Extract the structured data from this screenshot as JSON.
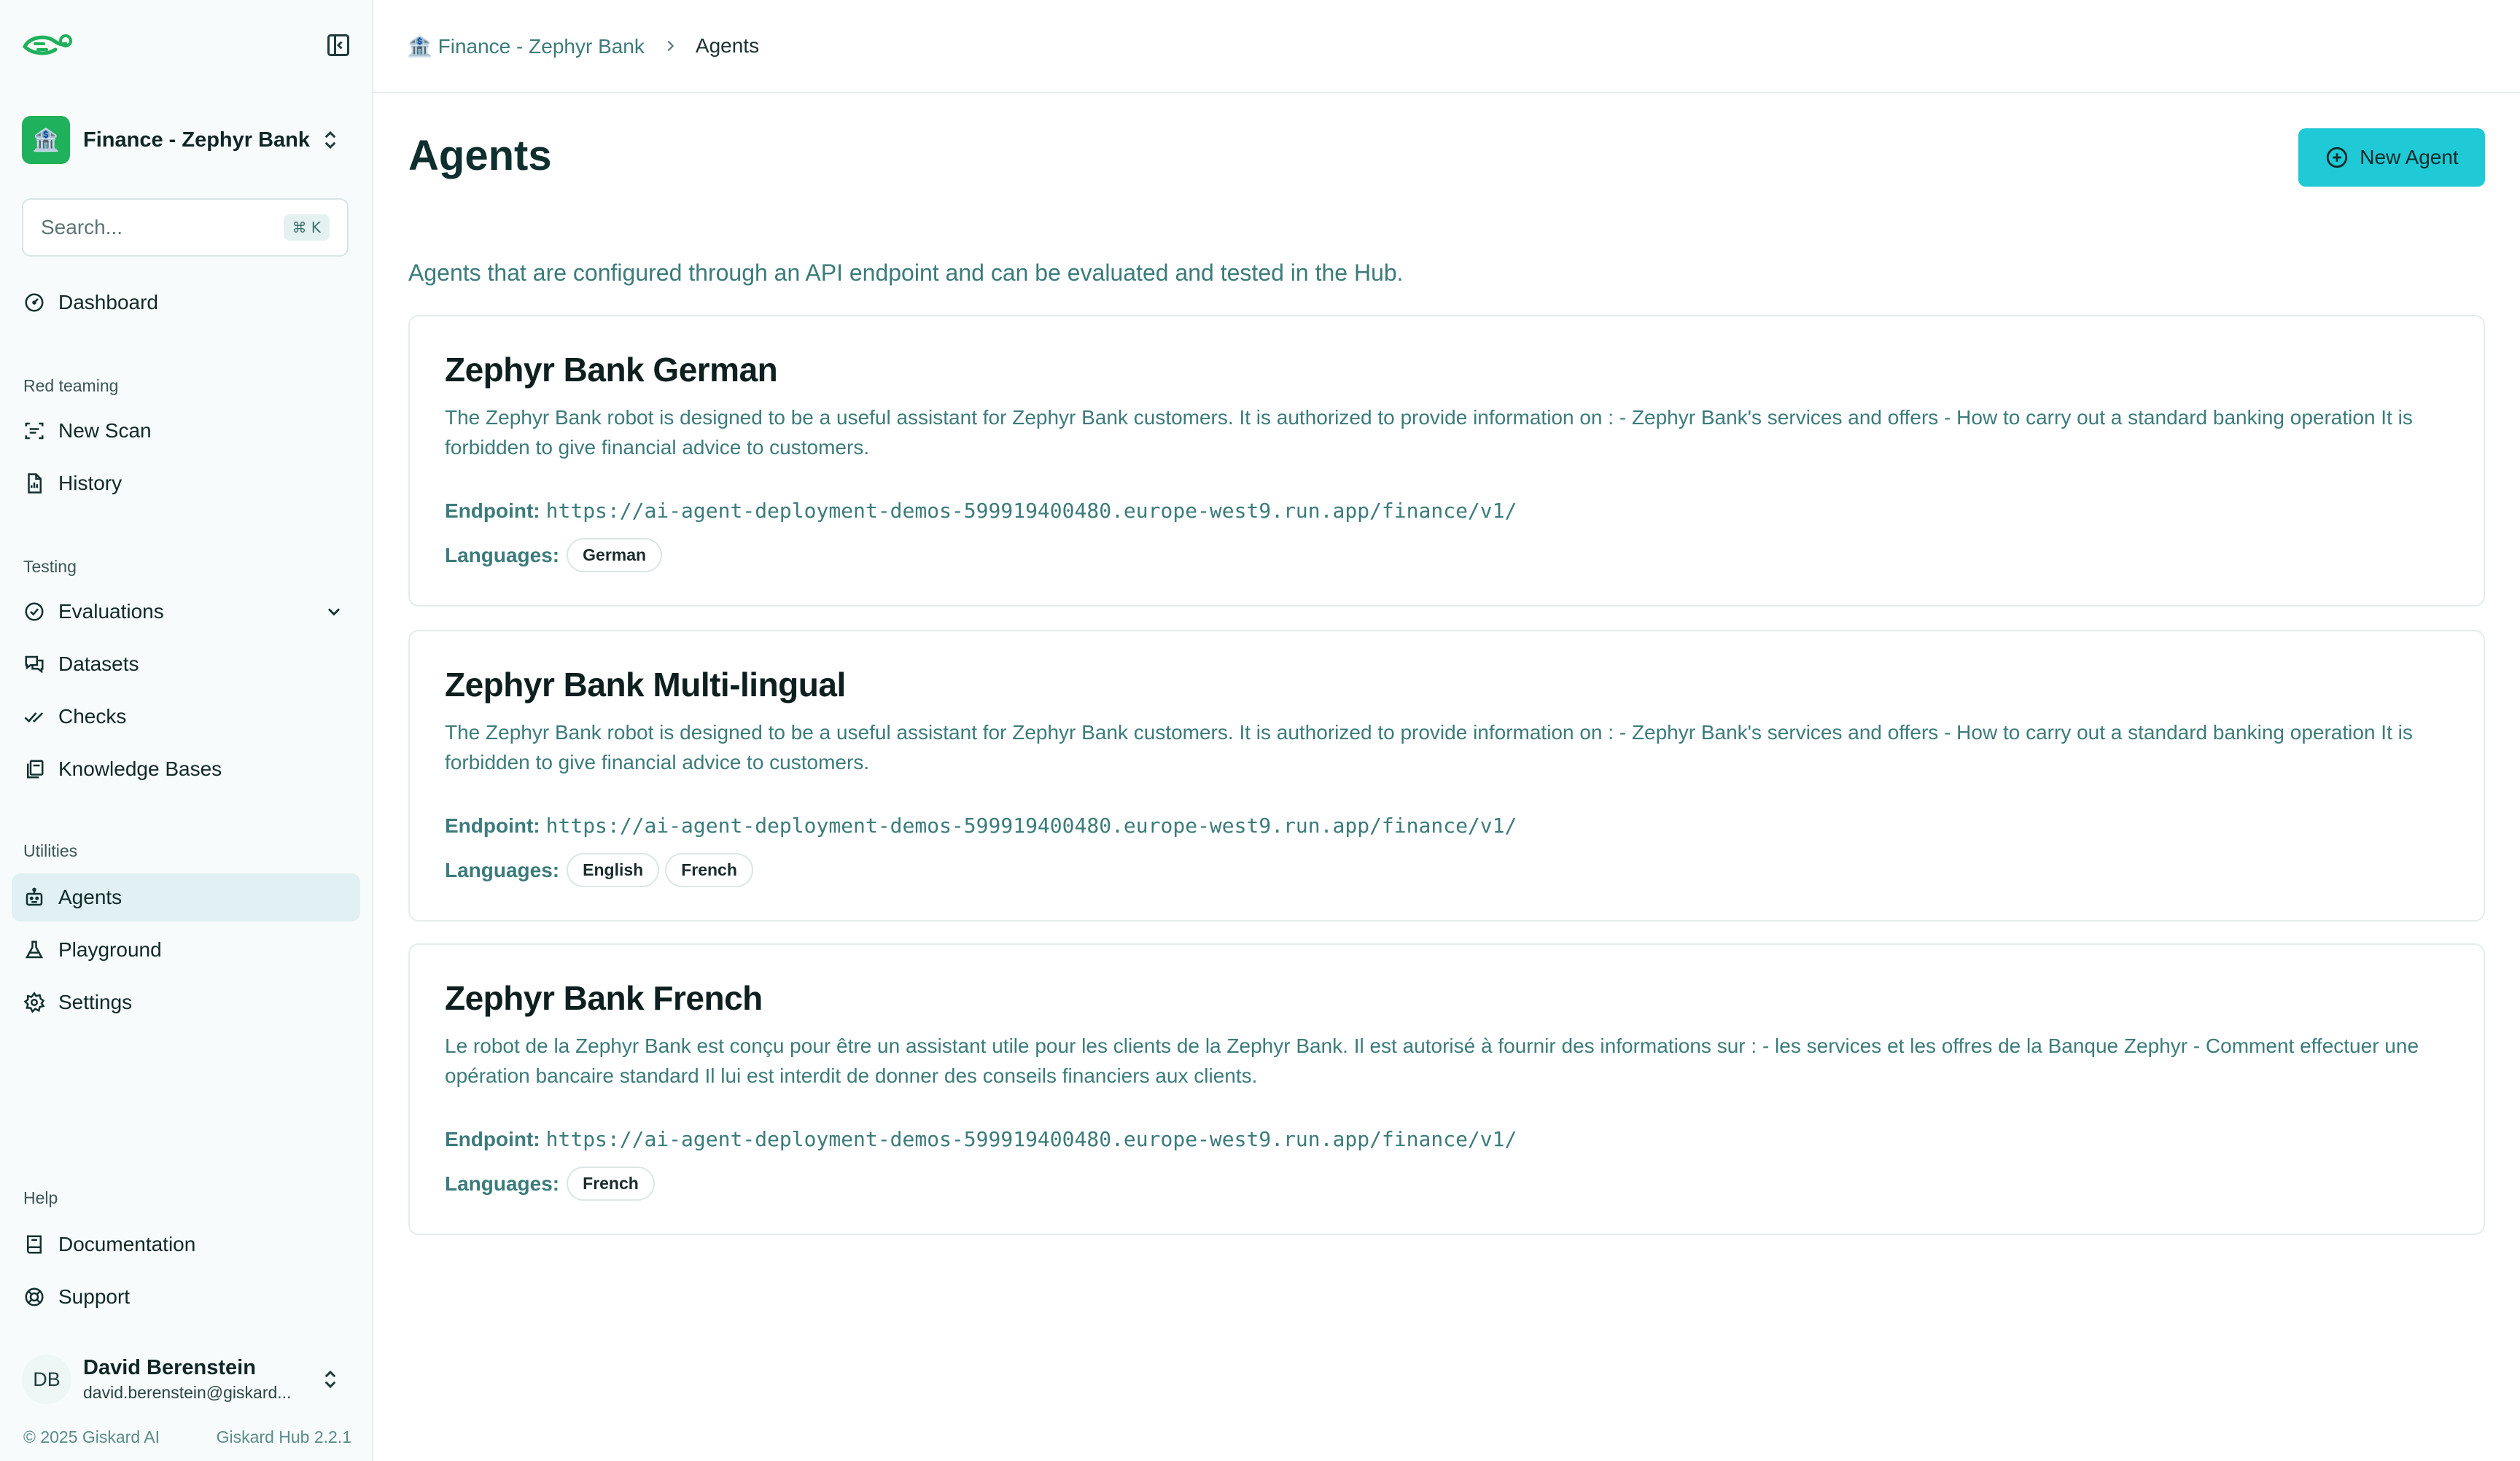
{
  "sidebar": {
    "workspace": {
      "name": "Finance - Zephyr Bank",
      "icon": "bank-icon"
    },
    "search": {
      "placeholder": "Search...",
      "shortcut": "⌘ K"
    },
    "dashboard": {
      "label": "Dashboard",
      "icon": "gauge-icon"
    },
    "sections": {
      "red_teaming": "Red teaming",
      "testing": "Testing",
      "utilities": "Utilities",
      "help": "Help"
    },
    "items": {
      "new_scan": {
        "label": "New Scan",
        "icon": "scan-icon"
      },
      "history": {
        "label": "History",
        "icon": "history-icon"
      },
      "evaluations": {
        "label": "Evaluations",
        "icon": "check-circle-icon"
      },
      "datasets": {
        "label": "Datasets",
        "icon": "chat-icon"
      },
      "checks": {
        "label": "Checks",
        "icon": "double-check-icon"
      },
      "knowledge_bases": {
        "label": "Knowledge Bases",
        "icon": "library-icon"
      },
      "agents": {
        "label": "Agents",
        "icon": "robot-icon"
      },
      "playground": {
        "label": "Playground",
        "icon": "flask-icon"
      },
      "settings": {
        "label": "Settings",
        "icon": "gear-icon"
      },
      "documentation": {
        "label": "Documentation",
        "icon": "book-icon"
      },
      "support": {
        "label": "Support",
        "icon": "lifebuoy-icon"
      }
    },
    "user": {
      "initials": "DB",
      "name": "David Berenstein",
      "email": "david.berenstein@giskard..."
    },
    "footer": {
      "copyright": "© 2025 Giskard AI",
      "version": "Giskard Hub 2.2.1"
    }
  },
  "breadcrumb": {
    "workspace": "🏦 Finance - Zephyr Bank",
    "current": "Agents"
  },
  "page": {
    "title": "Agents",
    "new_agent_label": "New Agent",
    "description": "Agents that are configured through an API endpoint and can be evaluated and tested in the Hub.",
    "endpoint_label": "Endpoint:",
    "languages_label": "Languages:"
  },
  "agents": [
    {
      "name": "Zephyr Bank German",
      "description": "The Zephyr Bank robot is designed to be a useful assistant for Zephyr Bank customers. It is authorized to provide information on : - Zephyr Bank's services and offers - How to carry out a standard banking operation It is forbidden to give financial advice to customers.",
      "endpoint": "https://ai-agent-deployment-demos-599919400480.europe-west9.run.app/finance/v1/",
      "languages": [
        "German"
      ]
    },
    {
      "name": "Zephyr Bank Multi-lingual",
      "description": "The Zephyr Bank robot is designed to be a useful assistant for Zephyr Bank customers. It is authorized to provide information on : - Zephyr Bank's services and offers - How to carry out a standard banking operation It is forbidden to give financial advice to customers.",
      "endpoint": "https://ai-agent-deployment-demos-599919400480.europe-west9.run.app/finance/v1/",
      "languages": [
        "English",
        "French"
      ]
    },
    {
      "name": "Zephyr Bank French",
      "description": "Le robot de la Zephyr Bank est conçu pour être un assistant utile pour les clients de la Zephyr Bank. Il est autorisé à fournir des informations sur : - les services et les offres de la Banque Zephyr - Comment effectuer une opération bancaire standard Il lui est interdit de donner des conseils financiers aux clients.",
      "endpoint": "https://ai-agent-deployment-demos-599919400480.europe-west9.run.app/finance/v1/",
      "languages": [
        "French"
      ]
    }
  ],
  "colors": {
    "accent": "#1fc9d6",
    "brand_green": "#1fb15b",
    "link_teal": "#3c7b7b",
    "active_nav": "#e1f1f3"
  }
}
